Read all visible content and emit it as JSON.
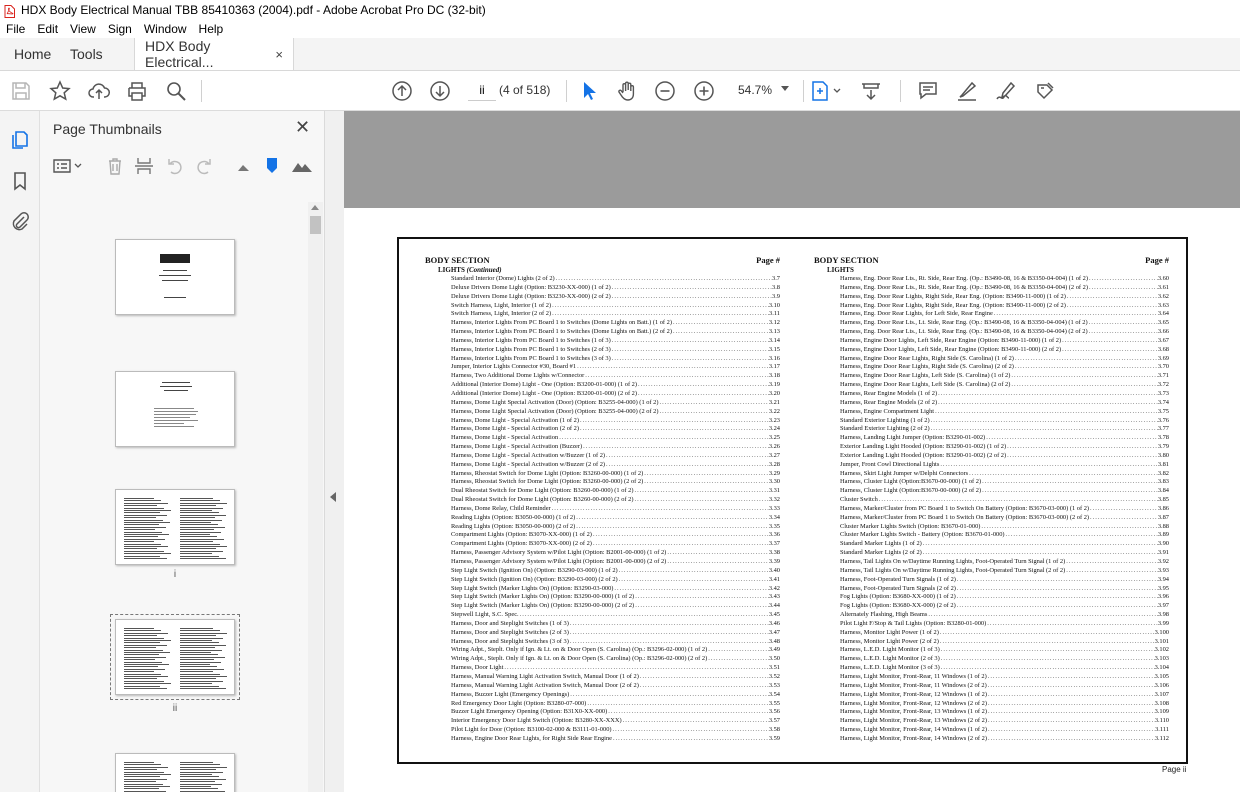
{
  "window": {
    "title": "HDX Body Electrical Manual TBB 85410363 (2004).pdf - Adobe Acrobat Pro DC (32-bit)"
  },
  "menu": [
    "File",
    "Edit",
    "View",
    "Sign",
    "Window",
    "Help"
  ],
  "tabs": {
    "home": "Home",
    "tools": "Tools",
    "doc": "HDX Body Electrical...",
    "close": "×"
  },
  "toolbar": {
    "page_value": "ii",
    "page_count": "(4 of 518)",
    "zoom": "54.7%"
  },
  "panel": {
    "title": "Page Thumbnails",
    "close": "✕"
  },
  "thumbs": [
    {
      "label": ""
    },
    {
      "label": ""
    },
    {
      "label": "i"
    },
    {
      "label": "ii"
    },
    {
      "label": ""
    }
  ],
  "document": {
    "section": "BODY SECTION",
    "page_hdr": "Page #",
    "left_sub_a": "LIGHTS",
    "left_sub_b": "(Continued)",
    "right_sub": "LIGHTS",
    "footer": "Page ii",
    "left_rows": [
      [
        "Standard Interior (Dome) Lights (2 of 2)",
        "3.7"
      ],
      [
        "Deluxe Drivers Dome Light (Option: B3230-XX-000) (1 of 2)",
        "3.8"
      ],
      [
        "Deluxe Drivers Dome Light (Option: B3230-XX-000) (2 of 2)",
        "3.9"
      ],
      [
        "Switch Harness, Light, Interior (1 of 2)",
        "3.10"
      ],
      [
        "Switch Harness, Light, Interior (2 of 2)",
        "3.11"
      ],
      [
        "Harness, Interior Lights From PC Board 1 to Switches (Dome Lights on Batt.) (1 of 2)",
        "3.12"
      ],
      [
        "Harness, Interior Lights From PC Board 1 to Switches (Dome Lights on Batt.) (2 of 2)",
        "3.13"
      ],
      [
        "Harness, Interior Lights From PC Board 1 to Switches (1 of 3)",
        "3.14"
      ],
      [
        "Harness, Interior Lights From PC Board 1 to Switches (2 of 3)",
        "3.15"
      ],
      [
        "Harness, Interior Lights From PC Board 1 to Switches (3 of 3)",
        "3.16"
      ],
      [
        "Jumper, Interior Lights Connector #30, Board #1",
        "3.17"
      ],
      [
        "Harness, Two Additional Dome Lights w/Connector",
        "3.18"
      ],
      [
        "Additional (Interior Dome) Light - One (Option: B3200-01-000) (1 of 2)",
        "3.19"
      ],
      [
        "Additional (Interior Dome) Light - One (Option: B3200-01-000) (2 of 2)",
        "3.20"
      ],
      [
        "Harness, Dome Light Special Activation (Door) (Option: B3255-04-000) (1 of 2)",
        "3.21"
      ],
      [
        "Harness, Dome Light Special Activation (Door) (Option: B3255-04-000) (2 of 2)",
        "3.22"
      ],
      [
        "Harness, Dome Light - Special Activation (1 of 2)",
        "3.23"
      ],
      [
        "Harness, Dome Light - Special Activation (2 of 2)",
        "3.24"
      ],
      [
        "Harness, Dome Light - Special Activation",
        "3.25"
      ],
      [
        "Harness, Dome Light - Special Activation (Buzzer)",
        "3.26"
      ],
      [
        "Harness, Dome Light - Special Activation w/Buzzer (1 of 2)",
        "3.27"
      ],
      [
        "Harness, Dome Light - Special Activation w/Buzzer (2 of 2)",
        "3.28"
      ],
      [
        "Harness, Rheostat Switch for Dome Light (Option: B3260-00-000) (1 of 2)",
        "3.29"
      ],
      [
        "Harness, Rheostat Switch for Dome Light (Option: B3260-00-000) (2 of 2)",
        "3.30"
      ],
      [
        "Dual Rheostat Switch for Dome Light (Option: B3260-00-000) (1 of 2)",
        "3.31"
      ],
      [
        "Dual Rheostat Switch for Dome Light (Option: B3260-00-000) (2 of 2)",
        "3.32"
      ],
      [
        "Harness, Dome Relay, Child Reminder",
        "3.33"
      ],
      [
        "Reading Lights (Option: B3050-00-000) (1 of 2)",
        "3.34"
      ],
      [
        "Reading Lights (Option: B3050-00-000) (2 of 2)",
        "3.35"
      ],
      [
        "Compartment Lights (Option: B3070-XX-000) (1 of 2)",
        "3.36"
      ],
      [
        "Compartment Lights (Option: B3070-XX-000) (2 of 2)",
        "3.37"
      ],
      [
        "Harness, Passenger Advisory System w/Pilot Light (Option: B2001-00-000) (1 of 2)",
        "3.38"
      ],
      [
        "Harness, Passenger Advisory System w/Pilot Light (Option: B2001-00-000) (2 of 2)",
        "3.39"
      ],
      [
        "Step Light Switch (Ignition On) (Option: B3290-03-000) (1 of 2)",
        "3.40"
      ],
      [
        "Step Light Switch (Ignition On) (Option: B3290-03-000) (2 of 2)",
        "3.41"
      ],
      [
        "Step Light Switch (Marker Lights On) (Option: B3290-03-000)",
        "3.42"
      ],
      [
        "Step Light Switch (Marker Lights On) (Option: B3290-00-000) (1 of 2)",
        "3.43"
      ],
      [
        "Step Light Switch (Marker Lights On) (Option: B3290-00-000) (2 of 2)",
        "3.44"
      ],
      [
        "Stepwell Light, S.C. Spec.",
        "3.45"
      ],
      [
        "Harness, Door and Steplight Switches (1 of 3)",
        "3.46"
      ],
      [
        "Harness, Door and Steplight Switches (2 of 3)",
        "3.47"
      ],
      [
        "Harness, Door and Steplight Switches (3 of 3)",
        "3.48"
      ],
      [
        "Wiring Adpt., Steplt. Only if Ign. & Lt. on & Door Open (S. Carolina) (Op.: B3296-02-000) (1 of 2)",
        "3.49"
      ],
      [
        "Wiring Adpt., Steplt. Only if Ign. & Lt. on & Door Open (S. Carolina) (Op.: B3296-02-000) (2 of 2)",
        "3.50"
      ],
      [
        "Harness, Door Light",
        "3.51"
      ],
      [
        "Harness, Manual Warning Light Activation Switch, Manual Door (1 of 2)",
        "3.52"
      ],
      [
        "Harness, Manual Warning Light Activation Switch, Manual Door (2 of 2)",
        "3.53"
      ],
      [
        "Harness, Buzzer Light (Emergency Openings)",
        "3.54"
      ],
      [
        "Red Emergency Door Light (Option: B3280-07-000)",
        "3.55"
      ],
      [
        "Buzzer Light Emergency Opening (Option: B31X0-XX-000)",
        "3.56"
      ],
      [
        "Interior Emergency Door Light Switch (Option: B3280-XX-XXX)",
        "3.57"
      ],
      [
        "Pilot Light for Door (Option: B3100-02-000 & B3111-01-000)",
        "3.58"
      ],
      [
        "Harness, Engine Door Rear Lights, for Right Side Rear Engine",
        "3.59"
      ]
    ],
    "right_rows": [
      [
        "Harness, Eng. Door Rear Lts., Rt. Side, Rear Eng. (Op.: B3490-08, 16 & B3350-04-004) (1 of 2)",
        "3.60"
      ],
      [
        "Harness, Eng. Door Rear Lts., Rt. Side, Rear Eng. (Op.: B3490-08, 16 & B3350-04-004) (2 of 2)",
        "3.61"
      ],
      [
        "Harness, Eng. Door Rear Lights, Right Side, Rear Eng. (Option: B3490-11-000) (1 of 2)",
        "3.62"
      ],
      [
        "Harness, Eng. Door Rear Lights, Right Side, Rear Eng. (Option: B3490-11-000) (2 of 2)",
        "3.63"
      ],
      [
        "Harness, Eng. Door Rear Lights, for Left Side, Rear Engine",
        "3.64"
      ],
      [
        "Harness, Eng. Door Rear Lts., Lt. Side, Rear Eng. (Op.: B3490-08, 16 & B3350-04-004) (1 of 2)",
        "3.65"
      ],
      [
        "Harness, Eng. Door Rear Lts., Lt. Side, Rear Eng. (Op.: B3490-08, 16 & B3350-04-004) (2 of 2)",
        "3.66"
      ],
      [
        "Harness, Engine Door Lights, Left Side, Rear Engine (Option: B3490-11-000) (1 of 2)",
        "3.67"
      ],
      [
        "Harness, Engine Door Lights, Left Side, Rear Engine (Option: B3490-11-000) (2 of 2)",
        "3.68"
      ],
      [
        "Harness, Engine Door Rear Lights, Right Side (S. Carolina) (1 of 2)",
        "3.69"
      ],
      [
        "Harness, Engine Door Rear Lights, Right Side (S. Carolina) (2 of 2)",
        "3.70"
      ],
      [
        "Harness, Engine Door Rear Lights, Left Side (S. Carolina) (1 of 2)",
        "3.71"
      ],
      [
        "Harness, Engine Door Rear Lights, Left Side (S. Carolina) (2 of 2)",
        "3.72"
      ],
      [
        "Harness, Rear Engine Models (1 of 2)",
        "3.73"
      ],
      [
        "Harness, Rear Engine Models (2 of 2)",
        "3.74"
      ],
      [
        "Harness, Engine Compartment Light",
        "3.75"
      ],
      [
        "Standard Exterior Lighting (1 of 2)",
        "3.76"
      ],
      [
        "Standard Exterior Lighting (2 of 2)",
        "3.77"
      ],
      [
        "Harness, Landing Light Jumper (Option: B3290-01-002)",
        "3.78"
      ],
      [
        "Exterior Landing Light Hooded (Option: B3290-01-002) (1 of 2)",
        "3.79"
      ],
      [
        "Exterior Landing Light Hooded (Option: B3290-01-002) (2 of 2)",
        "3.80"
      ],
      [
        "Jumper, Front Cowl Directional Lights",
        "3.81"
      ],
      [
        "Harness, Skirt Light Jumper w/Delphi Connectors",
        "3.82"
      ],
      [
        "Harness, Cluster Light (Option:B3670-00-000) (1 of 2)",
        "3.83"
      ],
      [
        "Harness, Cluster Light (Option:B3670-00-000) (2 of 2)",
        "3.84"
      ],
      [
        "Cluster Switch",
        "3.85"
      ],
      [
        "Harness, Marker/Cluster from PC Board 1 to Switch On Battery (Option: B3670-03-000) (1 of 2)",
        "3.86"
      ],
      [
        "Harness, Marker/Cluster from PC Board 1 to Switch On Battery (Option: B3670-03-000) (2 of 2)",
        "3.87"
      ],
      [
        "Cluster Marker Lights Switch (Option: B3670-01-000)",
        "3.88"
      ],
      [
        "Cluster Marker Lights Switch - Battery (Option: B3670-01-000)",
        "3.89"
      ],
      [
        "Standard Marker Lights (1 of 2)",
        "3.90"
      ],
      [
        "Standard Marker Lights (2 of 2)",
        "3.91"
      ],
      [
        "Harness, Tail Lights On w/Daytime Running Lights, Foot-Operated Turn Signal (1 of 2)",
        "3.92"
      ],
      [
        "Harness, Tail Lights On w/Daytime Running Lights, Foot-Operated Turn Signal (2 of 2)",
        "3.93"
      ],
      [
        "Harness, Foot-Operated Turn Signals (1 of 2)",
        "3.94"
      ],
      [
        "Harness, Foot-Operated Turn Signals (2 of 2)",
        "3.95"
      ],
      [
        "Fog Lights (Option: B3680-XX-000) (1 of 2)",
        "3.96"
      ],
      [
        "Fog Lights (Option: B3680-XX-000) (2 of 2)",
        "3.97"
      ],
      [
        "Alternately Flashing, High Beams",
        "3.98"
      ],
      [
        "Pilot Light F/Stop & Tail Lights (Option: B3280-01-000)",
        "3.99"
      ],
      [
        "Harness, Monitor Light Power (1 of 2)",
        "3.100"
      ],
      [
        "Harness, Monitor Light Power (2 of 2)",
        "3.101"
      ],
      [
        "Harness, L.E.D. Light Monitor (1 of 3)",
        "3.102"
      ],
      [
        "Harness, L.E.D. Light Monitor (2 of 3)",
        "3.103"
      ],
      [
        "Harness, L.E.D. Light Monitor (3 of 3)",
        "3.104"
      ],
      [
        "Harness, Light Monitor, Front-Rear, 11 Windows (1 of 2)",
        "3.105"
      ],
      [
        "Harness, Light Monitor, Front-Rear, 11 Windows (2 of 2)",
        "3.106"
      ],
      [
        "Harness, Light Monitor, Front-Rear, 12 Windows (1 of 2)",
        "3.107"
      ],
      [
        "Harness, Light Monitor, Front-Rear, 12 Windows (2 of 2)",
        "3.108"
      ],
      [
        "Harness, Light Monitor, Front-Rear, 13 Windows (1 of 2)",
        "3.109"
      ],
      [
        "Harness, Light Monitor, Front-Rear, 13 Windows (2 of 2)",
        "3.110"
      ],
      [
        "Harness, Light Monitor, Front-Rear, 14 Windows (1 of 2)",
        "3.111"
      ],
      [
        "Harness, Light Monitor, Front-Rear, 14 Windows (2 of 2)",
        "3.112"
      ]
    ]
  }
}
